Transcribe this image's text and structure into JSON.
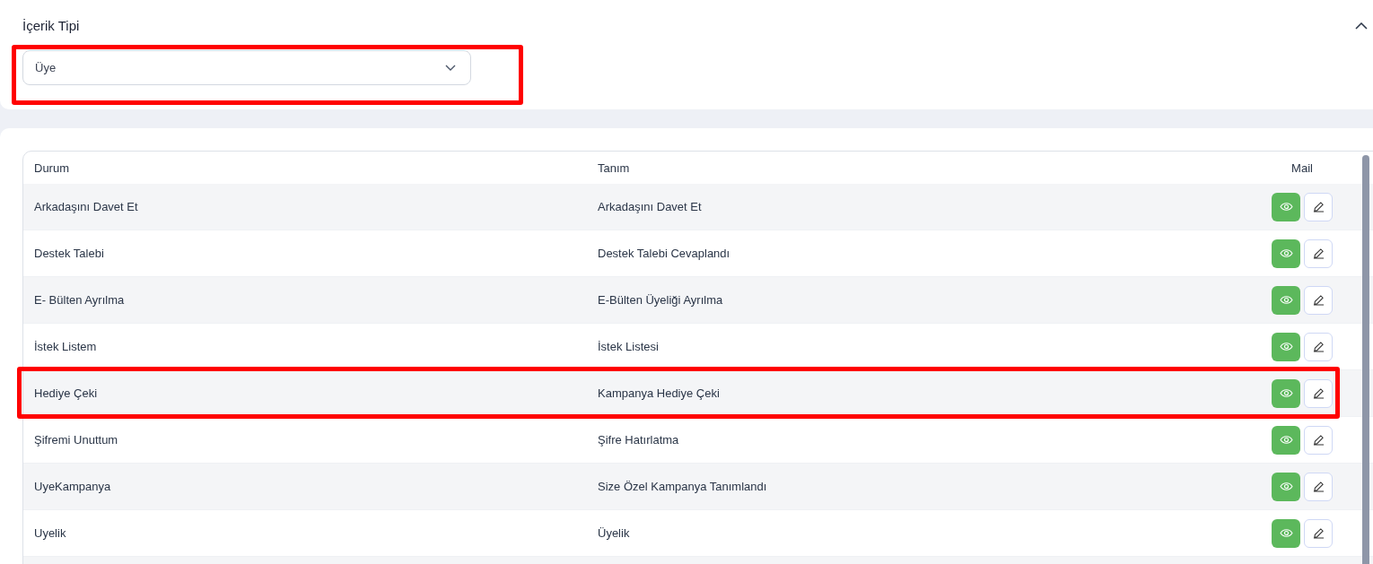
{
  "content_type": {
    "label": "İçerik Tipi",
    "value": "Üye",
    "highlighted": true,
    "expanded": true
  },
  "table": {
    "columns": [
      "Durum",
      "Tanım",
      "Mail"
    ],
    "rows": [
      {
        "status": "Arkadaşını Davet Et",
        "definition": "Arkadaşını Davet Et",
        "highlighted": false
      },
      {
        "status": "Destek Talebi",
        "definition": "Destek Talebi Cevaplandı",
        "highlighted": false
      },
      {
        "status": "E- Bülten Ayrılma",
        "definition": "E-Bülten Üyeliği Ayrılma",
        "highlighted": false
      },
      {
        "status": "İstek Listem",
        "definition": "İstek Listesi",
        "highlighted": false
      },
      {
        "status": "Hediye Çeki",
        "definition": "Kampanya Hediye Çeki",
        "highlighted": true
      },
      {
        "status": "Şifremi Unuttum",
        "definition": "Şifre Hatırlatma",
        "highlighted": false
      },
      {
        "status": "UyeKampanya",
        "definition": "Size Özel Kampanya Tanımlandı",
        "highlighted": false
      },
      {
        "status": "Uyelik",
        "definition": "Üyelik",
        "highlighted": false
      }
    ]
  }
}
